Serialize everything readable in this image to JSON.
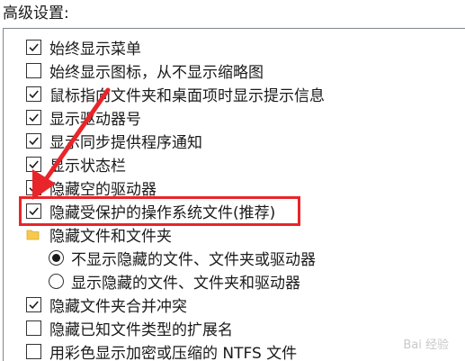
{
  "section_label": "高级设置:",
  "items": [
    {
      "type": "checkbox",
      "checked": true,
      "label": "始终显示菜单"
    },
    {
      "type": "checkbox",
      "checked": false,
      "label": "始终显示图标，从不显示缩略图"
    },
    {
      "type": "checkbox",
      "checked": true,
      "label": "鼠标指向文件夹和桌面项时显示提示信息"
    },
    {
      "type": "checkbox",
      "checked": true,
      "label": "显示驱动器号"
    },
    {
      "type": "checkbox",
      "checked": true,
      "label": "显示同步提供程序通知"
    },
    {
      "type": "checkbox",
      "checked": true,
      "label": "显示状态栏"
    },
    {
      "type": "checkbox",
      "checked": true,
      "label": "隐藏空的驱动器"
    },
    {
      "type": "checkbox",
      "checked": true,
      "label": "隐藏受保护的操作系统文件(推荐)"
    },
    {
      "type": "folder",
      "label": "隐藏文件和文件夹"
    },
    {
      "type": "radio",
      "checked": true,
      "label": "不显示隐藏的文件、文件夹或驱动器"
    },
    {
      "type": "radio",
      "checked": false,
      "label": "显示隐藏的文件、文件夹和驱动器"
    },
    {
      "type": "checkbox",
      "checked": true,
      "label": "隐藏文件夹合并冲突"
    },
    {
      "type": "checkbox",
      "checked": false,
      "label": "隐藏已知文件类型的扩展名"
    },
    {
      "type": "checkbox",
      "checked": false,
      "label": "用彩色显示加密或压缩的 NTFS 文件"
    }
  ],
  "highlight_color": "#e8252a",
  "watermark": "Bai 经验"
}
